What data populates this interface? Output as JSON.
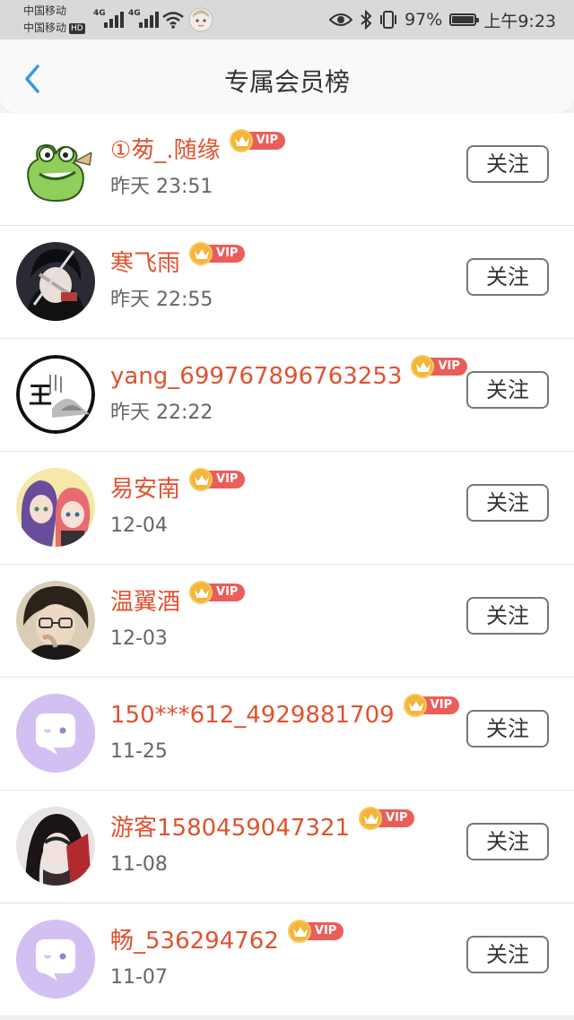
{
  "status_bar": {
    "carrier_1": "中国移动",
    "carrier_2": "中国移动",
    "hd": "HD",
    "net_1": "4G",
    "net_2": "4G",
    "battery_text": "97%",
    "battery_level": 0.97,
    "time": "上午9:23"
  },
  "nav": {
    "title": "专属会员榜"
  },
  "follow_label": "关注",
  "vip_label": "VIP",
  "members": [
    {
      "name": "①茐_.随缘",
      "time": "昨天 23:51",
      "avatar": "frog"
    },
    {
      "name": "寒飞雨",
      "time": "昨天 22:55",
      "avatar": "anime-dark"
    },
    {
      "name": "yang_699767896763253",
      "time": "昨天 22:22",
      "avatar": "ink-wang"
    },
    {
      "name": "易安南",
      "time": "12-04",
      "avatar": "anime-duo"
    },
    {
      "name": "温翼酒",
      "time": "12-03",
      "avatar": "anime-glasses"
    },
    {
      "name": "150***612_4929881709",
      "time": "11-25",
      "avatar": "default-chat"
    },
    {
      "name": "游客1580459047321",
      "time": "11-08",
      "avatar": "anime-red"
    },
    {
      "name": "畅_536294762",
      "time": "11-07",
      "avatar": "default-chat"
    }
  ]
}
